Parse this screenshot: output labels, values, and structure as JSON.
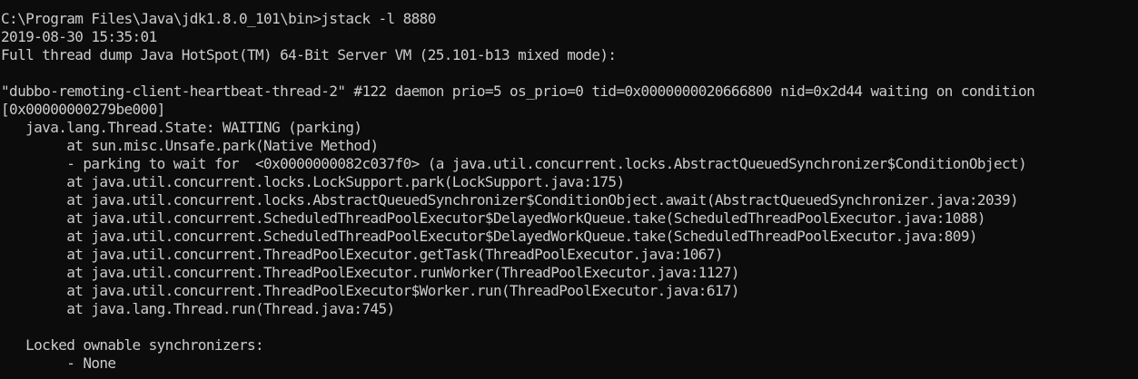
{
  "terminal": {
    "background": "#0c0c0c",
    "foreground": "#cccccc",
    "lines": [
      "C:\\Program Files\\Java\\jdk1.8.0_101\\bin>jstack -l 8880",
      "2019-08-30 15:35:01",
      "Full thread dump Java HotSpot(TM) 64-Bit Server VM (25.101-b13 mixed mode):",
      "",
      "\"dubbo-remoting-client-heartbeat-thread-2\" #122 daemon prio=5 os_prio=0 tid=0x0000000020666800 nid=0x2d44 waiting on condition",
      "[0x00000000279be000]",
      "   java.lang.Thread.State: WAITING (parking)",
      "        at sun.misc.Unsafe.park(Native Method)",
      "        - parking to wait for  <0x0000000082c037f0> (a java.util.concurrent.locks.AbstractQueuedSynchronizer$ConditionObject)",
      "        at java.util.concurrent.locks.LockSupport.park(LockSupport.java:175)",
      "        at java.util.concurrent.locks.AbstractQueuedSynchronizer$ConditionObject.await(AbstractQueuedSynchronizer.java:2039)",
      "        at java.util.concurrent.ScheduledThreadPoolExecutor$DelayedWorkQueue.take(ScheduledThreadPoolExecutor.java:1088)",
      "        at java.util.concurrent.ScheduledThreadPoolExecutor$DelayedWorkQueue.take(ScheduledThreadPoolExecutor.java:809)",
      "        at java.util.concurrent.ThreadPoolExecutor.getTask(ThreadPoolExecutor.java:1067)",
      "        at java.util.concurrent.ThreadPoolExecutor.runWorker(ThreadPoolExecutor.java:1127)",
      "        at java.util.concurrent.ThreadPoolExecutor$Worker.run(ThreadPoolExecutor.java:617)",
      "        at java.lang.Thread.run(Thread.java:745)",
      "",
      "   Locked ownable synchronizers:",
      "        - None"
    ]
  }
}
